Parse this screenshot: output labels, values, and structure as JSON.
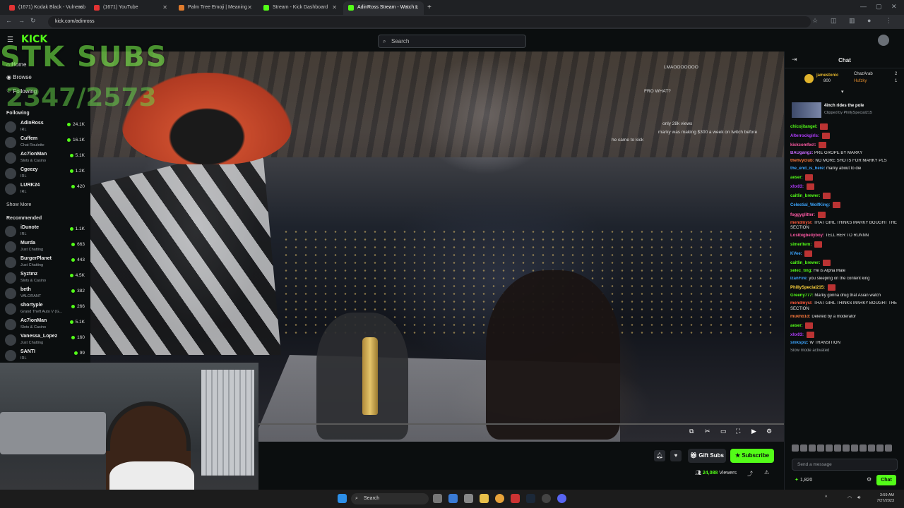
{
  "browser": {
    "tabs": [
      {
        "title": "(1671) Kodak Black - Vulnerab",
        "color": "#e23333"
      },
      {
        "title": "(1671) YouTube",
        "color": "#e23333"
      },
      {
        "title": "Palm Tree Emoji | Meaning",
        "color": "#e07b2c"
      },
      {
        "title": "Stream - Kick Dashboard",
        "color": "#53fc18"
      },
      {
        "title": "AdinRoss Stream - Watch L",
        "color": "#53fc18"
      }
    ],
    "url": "kick.com/adinross"
  },
  "kick": {
    "logo": "KICK",
    "search_placeholder": "Search",
    "nav": {
      "home": "Home",
      "browse": "Browse",
      "following_nav": "Following"
    },
    "following_title": "Following",
    "following": [
      {
        "name": "AdinRoss",
        "category": "IRL",
        "viewers": "24.1K"
      },
      {
        "name": "Cuffem",
        "category": "Chat Roulette",
        "viewers": "16.1K"
      },
      {
        "name": "Ac7ionMan",
        "category": "Slots & Casino",
        "viewers": "5.1K"
      },
      {
        "name": "Cgeezy",
        "category": "IRL",
        "viewers": "1.2K"
      },
      {
        "name": "LURK24",
        "category": "IRL",
        "viewers": "420"
      }
    ],
    "show_more": "Show More",
    "recommended_title": "Recommended",
    "recommended": [
      {
        "name": "iDunote",
        "category": "IRL",
        "viewers": "1.1K"
      },
      {
        "name": "Murda",
        "category": "Just Chatting",
        "viewers": "663"
      },
      {
        "name": "BurgerPlanet",
        "category": "Just Chatting",
        "viewers": "443"
      },
      {
        "name": "Syztmz",
        "category": "Slots & Casino",
        "viewers": "4.5K"
      },
      {
        "name": "beth",
        "category": "VALORANT",
        "viewers": "382"
      },
      {
        "name": "shortyple",
        "category": "Grand Theft Auto V (G...",
        "viewers": "266"
      },
      {
        "name": "Ac7ionMan",
        "category": "Slots & Casino",
        "viewers": "5.1K"
      },
      {
        "name": "Vanessa_Lopez",
        "category": "Just Chatting",
        "viewers": "160"
      },
      {
        "name": "SANTI",
        "category": "IRL",
        "viewers": "99"
      }
    ]
  },
  "overlay": {
    "subs_text": "STK SUBS",
    "count_text": "2347/2573"
  },
  "video_chat_overlay": [
    "LMAOOOOOOO",
    "FRO WHAT?",
    "only 28k views",
    "marky was making $300 a week on twitch before",
    "he came to kick"
  ],
  "player": {
    "gift_label": "Gift Subs",
    "subscribe_label": "Subscribe",
    "viewers_count": "24,088",
    "viewers_label": "Viewers"
  },
  "chat": {
    "title": "Chat",
    "gifters": [
      {
        "name": "jamestonic",
        "count": "800"
      },
      {
        "name": "ChazArab",
        "count": "2"
      },
      {
        "name": "Hufzky",
        "count": "1"
      }
    ],
    "clip": {
      "title": "4inch rides the pole",
      "by": "Clipped by PhillySpecial215"
    },
    "messages": [
      {
        "user": "chicojitangel:",
        "text": "",
        "color": "#53fc18"
      },
      {
        "user": "Alterrockgirls:",
        "text": "",
        "color": "#b23cff"
      },
      {
        "user": "kickcomfect:",
        "text": "",
        "color": "#ff5aa5"
      },
      {
        "user": "BAUgangz:",
        "text": "PRE GROPE BY MARKY",
        "color": "#c86bff"
      },
      {
        "user": "thehvyclub:",
        "text": "NO MORE SHOTS FOR MARKY PLS",
        "color": "#ff7a3c"
      },
      {
        "user": "the_end_is_here:",
        "text": "marky about to die",
        "color": "#3ca6ff"
      },
      {
        "user": "aeser:",
        "text": "",
        "color": "#53fc18"
      },
      {
        "user": "xhx03:",
        "text": "",
        "color": "#b23cff"
      },
      {
        "user": "caitlin_brewer:",
        "text": "",
        "color": "#53fc18"
      },
      {
        "user": "Celestial_WolfKing:",
        "text": "",
        "color": "#3ca6ff"
      },
      {
        "user": "foggyglitter:",
        "text": "",
        "color": "#ff5aa5"
      },
      {
        "user": "mendmysl:",
        "text": "THAT GIRL THINKS MARKY BOUGHT THE SECTION",
        "color": "#ff5a3c"
      },
      {
        "user": "Lostbigbellyboy:",
        "text": "TELL HER TO RUNNN",
        "color": "#ff5aa5"
      },
      {
        "user": "simeritem:",
        "text": "",
        "color": "#53fc18"
      },
      {
        "user": "KVee:",
        "text": "",
        "color": "#3ca6ff"
      },
      {
        "user": "caitlin_brewer:",
        "text": "",
        "color": "#53fc18"
      },
      {
        "user": "selec_ting:",
        "text": "He is Alpha Male",
        "color": "#53fc18"
      },
      {
        "user": "IzanFire:",
        "text": "you sleeping on the content king",
        "color": "#3ca6ff"
      },
      {
        "user": "PhillySpecial215:",
        "text": "",
        "color": "#ffd43c"
      },
      {
        "user": "Greeny777:",
        "text": "Marky gonna drug that Asian watch",
        "color": "#53fc18"
      },
      {
        "user": "mendmysl:",
        "text": "THAT GIRL THINKS MARKY BOUGHT THE SECTION",
        "color": "#ff5a3c"
      },
      {
        "user": "mukhb1d:",
        "text": "Deleted by a moderator",
        "color": "#ff7a3c"
      },
      {
        "user": "aeser:",
        "text": "",
        "color": "#53fc18"
      },
      {
        "user": "xhx03:",
        "text": "",
        "color": "#b23cff"
      },
      {
        "user": "sniksplz:",
        "text": "W TRANSITION",
        "color": "#3ca6ff"
      },
      {
        "user": "",
        "text": "Slow mode activated",
        "color": "#9aa0a6"
      }
    ],
    "input_placeholder": "Send a message",
    "points": "1,820",
    "chat_button": "Chat"
  },
  "taskbar": {
    "search": "Search",
    "time": "3:59 AM",
    "date": "7/27/2023"
  }
}
